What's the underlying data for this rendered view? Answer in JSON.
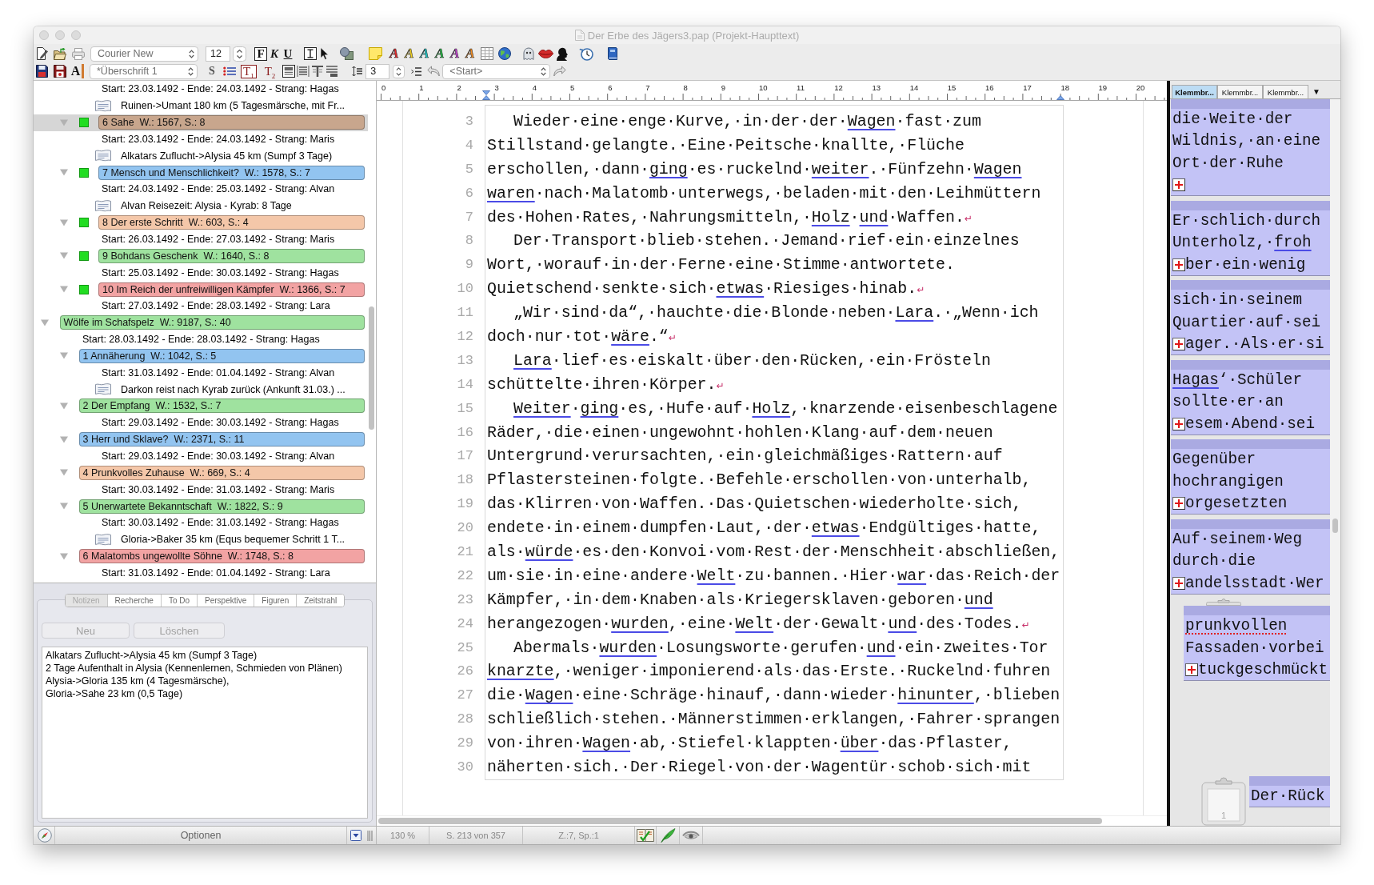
{
  "window": {
    "title": "Der Erbe des Jägers3.pap (Projekt-Haupttext)"
  },
  "toolbar": {
    "font": {
      "value": "Courier New"
    },
    "font_size": {
      "value": "12"
    },
    "format_buttons": [
      {
        "kind": "bold",
        "label": "F",
        "pressed": true
      },
      {
        "kind": "italic",
        "label": "K",
        "pressed": false
      },
      {
        "kind": "underline",
        "label": "U",
        "pressed": false
      }
    ],
    "pointer_tools": [
      {
        "pressed": true
      },
      {
        "pressed": false
      }
    ],
    "highlight_buttons": [
      {
        "label": "A",
        "color": "#e8262a"
      },
      {
        "label": "A",
        "color": "#f0d020"
      },
      {
        "label": "A",
        "color": "#18c8c8"
      },
      {
        "label": "A",
        "color": "#20b840"
      },
      {
        "label": "A",
        "color": "#c040d0"
      },
      {
        "label": "A",
        "color": "#f08a20"
      }
    ],
    "style_button": {
      "label": "A"
    },
    "paragraph_style": {
      "value": "*Überschrift 1"
    },
    "s_button": {
      "label": "S"
    },
    "level_buttons": [
      {
        "label": "T$_{1}$",
        "pressed": true
      },
      {
        "label": "T$_{2}$",
        "pressed": false
      }
    ],
    "layout_buttons": [
      {
        "pressed": true
      },
      {
        "pressed": false
      },
      {
        "pressed": false
      },
      {
        "pressed": false
      }
    ],
    "line_spacing": {
      "value": "3"
    },
    "position": {
      "value": "<Start>"
    }
  },
  "outline": [
    {
      "children": [
        {
          "children": [
            {
              "kind": "dates",
              "text": "Start: 23.03.1492 - Ende: 24.03.1492 - Strang: Hagas",
              "selected": false
            },
            {
              "kind": "note",
              "text": "Ruinen->Umant 180 km (5 Tagesmärsche, mit Fr...",
              "selected": false
            }
          ]
        },
        {
          "kind": "chapter",
          "label": "6 Sahe  W.: 1567, S.: 8",
          "color": "#c8a68d",
          "expanded": true,
          "selected": true,
          "status_box": true,
          "children": [
            {
              "kind": "dates",
              "text": "Start: 23.03.1492 - Ende: 24.03.1492 - Strang: Maris",
              "selected": false
            },
            {
              "kind": "note",
              "text": "Alkatars Zuflucht->Alysia 45 km (Sumpf 3 Tage)",
              "selected": false
            }
          ]
        },
        {
          "kind": "chapter",
          "label": "7 Mensch und Menschlichkeit?  W.: 1578, S.: 7",
          "color": "#92c4f0",
          "expanded": true,
          "selected": false,
          "status_box": true,
          "children": [
            {
              "kind": "dates",
              "text": "Start: 24.03.1492 - Ende: 25.03.1492 - Strang: Alvan",
              "selected": false
            },
            {
              "kind": "note",
              "text": "Alvan Reisezeit: Alysia - Kyrab: 8 Tage",
              "selected": false
            }
          ]
        },
        {
          "kind": "chapter",
          "label": "8 Der erste Schritt  W.: 603, S.: 4",
          "color": "#f4c7a9",
          "expanded": true,
          "selected": false,
          "status_box": true,
          "children": [
            {
              "kind": "dates",
              "text": "Start: 26.03.1492 - Ende: 27.03.1492 - Strang: Maris",
              "selected": false
            }
          ]
        },
        {
          "kind": "chapter",
          "label": "9 Bohdans Geschenk  W.: 1640, S.: 8",
          "color": "#9fe29f",
          "expanded": true,
          "selected": false,
          "status_box": true,
          "children": [
            {
              "kind": "dates",
              "text": "Start: 25.03.1492 - Ende: 30.03.1492 - Strang: Hagas",
              "selected": false
            }
          ]
        },
        {
          "kind": "chapter",
          "label": "10 Im Reich der unfreiwilligen Kämpfer  W.: 1366, S.: 7",
          "color": "#f2a3a3",
          "expanded": true,
          "selected": false,
          "status_box": true,
          "children": [
            {
              "kind": "dates",
              "text": "Start: 27.03.1492 - Ende: 28.03.1492 - Strang: Lara",
              "selected": false
            }
          ]
        }
      ]
    },
    {
      "kind": "part",
      "label": "Wölfe im Schafspelz  W.: 9187, S.: 40",
      "color": "#9fe29f",
      "expanded": true,
      "selected": false,
      "status_box": false,
      "children": [
        {
          "kind": "dates",
          "text": "Start: 28.03.1492 - Ende: 28.03.1492 - Strang: Hagas",
          "selected": false
        },
        {
          "kind": "chapter",
          "label": "1 Annäherung  W.: 1042, S.: 5",
          "color": "#92c4f0",
          "expanded": true,
          "selected": false,
          "status_box": false,
          "children": [
            {
              "kind": "dates",
              "text": "Start: 31.03.1492 - Ende: 01.04.1492 - Strang: Alvan",
              "selected": false
            },
            {
              "kind": "note",
              "text": "Darkon reist nach Kyrab zurück (Ankunft 31.03.) ...",
              "selected": false
            }
          ]
        },
        {
          "kind": "chapter",
          "label": "2 Der Empfang  W.: 1532, S.: 7",
          "color": "#9fe29f",
          "expanded": true,
          "selected": false,
          "status_box": false,
          "children": [
            {
              "kind": "dates",
              "text": "Start: 29.03.1492 - Ende: 30.03.1492 - Strang: Hagas",
              "selected": false
            }
          ]
        },
        {
          "kind": "chapter",
          "label": "3 Herr und Sklave?  W.: 2371, S.: 11",
          "color": "#92c4f0",
          "expanded": true,
          "selected": false,
          "status_box": false,
          "children": [
            {
              "kind": "dates",
              "text": "Start: 29.03.1492 - Ende: 30.03.1492 - Strang: Alvan",
              "selected": false
            }
          ]
        },
        {
          "kind": "chapter",
          "label": "4 Prunkvolles Zuhause  W.: 669, S.: 4",
          "color": "#f4c7a9",
          "expanded": true,
          "selected": false,
          "status_box": false,
          "children": [
            {
              "kind": "dates",
              "text": "Start: 30.03.1492 - Ende: 31.03.1492 - Strang: Maris",
              "selected": false
            }
          ]
        },
        {
          "kind": "chapter",
          "label": "5 Unerwartete Bekanntschaft  W.: 1822, S.: 9",
          "color": "#9fe29f",
          "expanded": true,
          "selected": false,
          "status_box": false,
          "children": [
            {
              "kind": "dates",
              "text": "Start: 30.03.1492 - Ende: 31.03.1492 - Strang: Hagas",
              "selected": false
            },
            {
              "kind": "note",
              "text": "Gloria->Baker 35 km (Equs bequemer Schritt 1 T...",
              "selected": false
            }
          ]
        },
        {
          "kind": "chapter",
          "label": "6 Malatombs ungewollte Söhne  W.: 1748, S.: 8",
          "color": "#f2a3a3",
          "expanded": true,
          "selected": false,
          "status_box": false,
          "children": [
            {
              "kind": "dates",
              "text": "Start: 31.03.1492 - Ende: 01.04.1492 - Strang: Lara",
              "selected": false
            }
          ]
        }
      ]
    }
  ],
  "notes_panel": {
    "tabs": [
      {
        "label": "Notizen",
        "selected": true
      },
      {
        "label": "Recherche",
        "selected": false
      },
      {
        "label": "To Do",
        "selected": false
      },
      {
        "label": "Perspektive",
        "selected": false
      },
      {
        "label": "Figuren",
        "selected": false
      },
      {
        "label": "Zeitstrahl",
        "selected": false
      }
    ],
    "buttons": [
      {
        "label": "Neu",
        "disabled": true
      },
      {
        "label": "Löschen",
        "disabled": true
      }
    ],
    "text_lines": [
      "Alkatars Zuflucht->Alysia 45 km (Sumpf 3 Tage)",
      "2 Tage Aufenthalt in Alysia (Kennenlernen, Schmieden von Plänen)",
      "Alysia->Gloria 135 km (4 Tagesmärsche),",
      "Gloria->Sahe 23 km (0,5 Tage)"
    ],
    "options_button": {
      "label": "Optionen"
    }
  },
  "ruler": {
    "labels": [
      "0",
      "1",
      "2",
      "3",
      "4",
      "5",
      "6",
      "7",
      "8",
      "9",
      "10",
      "11",
      "12",
      "13",
      "14",
      "15",
      "16",
      "17",
      "18",
      "19",
      "20"
    ]
  },
  "editor": {
    "lines": [
      {
        "number": "3",
        "indent": true,
        "segments": [
          {
            "kind": "plain",
            "text": "Wieder·eine·enge·Kurve,·in·der·der·"
          },
          {
            "kind": "marked",
            "text": "Wagen"
          },
          {
            "kind": "plain",
            "text": "·fast·zum"
          }
        ]
      },
      {
        "number": "4",
        "indent": false,
        "segments": [
          {
            "kind": "plain",
            "text": "Stillstand·gelangte.·Eine·Peitsche·knallte,·Flüche"
          }
        ]
      },
      {
        "number": "5",
        "indent": false,
        "segments": [
          {
            "kind": "plain",
            "text": "erschollen,·dann·"
          },
          {
            "kind": "marked",
            "text": "ging"
          },
          {
            "kind": "plain",
            "text": "·es·ruckelnd·"
          },
          {
            "kind": "marked",
            "text": "weiter"
          },
          {
            "kind": "plain",
            "text": ".·Fünfzehn·"
          },
          {
            "kind": "marked",
            "text": "Wagen"
          }
        ]
      },
      {
        "number": "6",
        "indent": false,
        "segments": [
          {
            "kind": "marked",
            "text": "waren"
          },
          {
            "kind": "plain",
            "text": "·nach·Malatomb·unterwegs,·beladen·mit·den·Leihmüttern"
          }
        ]
      },
      {
        "number": "7",
        "indent": false,
        "segments": [
          {
            "kind": "plain",
            "text": "des·Hohen·Rates,·Nahrungsmitteln,·"
          },
          {
            "kind": "marked",
            "text": "Holz"
          },
          {
            "kind": "plain",
            "text": "·"
          },
          {
            "kind": "marked",
            "text": "und"
          },
          {
            "kind": "plain",
            "text": "·Waffen."
          },
          {
            "kind": "return",
            "text": "↵"
          }
        ]
      },
      {
        "number": "8",
        "indent": true,
        "segments": [
          {
            "kind": "plain",
            "text": "Der·Transport·blieb·stehen.·Jemand·rief·ein·einzelnes"
          }
        ]
      },
      {
        "number": "9",
        "indent": false,
        "segments": [
          {
            "kind": "plain",
            "text": "Wort,·worauf·in·der·Ferne·eine·Stimme·antwortete."
          }
        ]
      },
      {
        "number": "10",
        "indent": false,
        "segments": [
          {
            "kind": "plain",
            "text": "Quietschend·senkte·sich·"
          },
          {
            "kind": "marked",
            "text": "etwas"
          },
          {
            "kind": "plain",
            "text": "·Riesiges·hinab."
          },
          {
            "kind": "return",
            "text": "↵"
          }
        ]
      },
      {
        "number": "11",
        "indent": true,
        "segments": [
          {
            "kind": "plain",
            "text": "„Wir·sind·da“,·hauchte·die·Blonde·neben·"
          },
          {
            "kind": "marked",
            "text": "Lara"
          },
          {
            "kind": "plain",
            "text": ".·„Wenn·ich"
          }
        ]
      },
      {
        "number": "12",
        "indent": false,
        "segments": [
          {
            "kind": "plain",
            "text": "doch·nur·tot·"
          },
          {
            "kind": "marked",
            "text": "wäre"
          },
          {
            "kind": "plain",
            "text": ".“"
          },
          {
            "kind": "return",
            "text": "↵"
          }
        ]
      },
      {
        "number": "13",
        "indent": true,
        "segments": [
          {
            "kind": "marked",
            "text": "Lara"
          },
          {
            "kind": "plain",
            "text": "·lief·es·eiskalt·über·den·Rücken,·ein·Frösteln"
          }
        ]
      },
      {
        "number": "14",
        "indent": false,
        "segments": [
          {
            "kind": "plain",
            "text": "schüttelte·ihren·Körper."
          },
          {
            "kind": "return",
            "text": "↵"
          }
        ]
      },
      {
        "number": "15",
        "indent": true,
        "segments": [
          {
            "kind": "marked",
            "text": "Weiter"
          },
          {
            "kind": "plain",
            "text": "·"
          },
          {
            "kind": "marked",
            "text": "ging"
          },
          {
            "kind": "plain",
            "text": "·es,·Hufe·auf·"
          },
          {
            "kind": "marked",
            "text": "Holz"
          },
          {
            "kind": "plain",
            "text": ",·knarzende·eisenbeschlagene"
          }
        ]
      },
      {
        "number": "16",
        "indent": false,
        "segments": [
          {
            "kind": "plain",
            "text": "Räder,·die·einen·ungewohnt·hohlen·Klang·auf·dem·neuen"
          }
        ]
      },
      {
        "number": "17",
        "indent": false,
        "segments": [
          {
            "kind": "plain",
            "text": "Untergrund·verursachten,·ein·gleichmäßiges·Rattern·auf"
          }
        ]
      },
      {
        "number": "18",
        "indent": false,
        "segments": [
          {
            "kind": "plain",
            "text": "Pflastersteinen·folgte.·Befehle·erschollen·von·unterhalb,"
          }
        ]
      },
      {
        "number": "19",
        "indent": false,
        "segments": [
          {
            "kind": "plain",
            "text": "das·Klirren·von·Waffen.·Das·Quietschen·wiederholte·sich,"
          }
        ]
      },
      {
        "number": "20",
        "indent": false,
        "segments": [
          {
            "kind": "plain",
            "text": "endete·in·einem·dumpfen·Laut,·der·"
          },
          {
            "kind": "marked",
            "text": "etwas"
          },
          {
            "kind": "plain",
            "text": "·Endgültiges·hatte,"
          }
        ]
      },
      {
        "number": "21",
        "indent": false,
        "segments": [
          {
            "kind": "plain",
            "text": "als·"
          },
          {
            "kind": "marked",
            "text": "würde"
          },
          {
            "kind": "plain",
            "text": "·es·den·Konvoi·vom·Rest·der·Menschheit·abschließen,"
          }
        ]
      },
      {
        "number": "22",
        "indent": false,
        "segments": [
          {
            "kind": "plain",
            "text": "um·sie·in·eine·andere·"
          },
          {
            "kind": "marked",
            "text": "Welt"
          },
          {
            "kind": "plain",
            "text": "·zu·bannen.·Hier·"
          },
          {
            "kind": "marked",
            "text": "war"
          },
          {
            "kind": "plain",
            "text": "·das·Reich·der"
          }
        ]
      },
      {
        "number": "23",
        "indent": false,
        "segments": [
          {
            "kind": "plain",
            "text": "Kämpfer,·in·dem·Knaben·als·Kriegersklaven·geboren·"
          },
          {
            "kind": "marked",
            "text": "und"
          }
        ]
      },
      {
        "number": "24",
        "indent": false,
        "segments": [
          {
            "kind": "plain",
            "text": "herangezogen·"
          },
          {
            "kind": "marked",
            "text": "wurden"
          },
          {
            "kind": "plain",
            "text": ",·eine·"
          },
          {
            "kind": "marked",
            "text": "Welt"
          },
          {
            "kind": "plain",
            "text": "·der·Gewalt·"
          },
          {
            "kind": "marked",
            "text": "und"
          },
          {
            "kind": "plain",
            "text": "·des·Todes."
          },
          {
            "kind": "return",
            "text": "↵"
          }
        ]
      },
      {
        "number": "25",
        "indent": true,
        "segments": [
          {
            "kind": "plain",
            "text": "Abermals·"
          },
          {
            "kind": "marked",
            "text": "wurden"
          },
          {
            "kind": "plain",
            "text": "·Losungsworte·gerufen·"
          },
          {
            "kind": "marked",
            "text": "und"
          },
          {
            "kind": "plain",
            "text": "·ein·zweites·Tor"
          }
        ]
      },
      {
        "number": "26",
        "indent": false,
        "segments": [
          {
            "kind": "marked",
            "text": "knarzte"
          },
          {
            "kind": "plain",
            "text": ",·weniger·imponierend·als·das·Erste.·Ruckelnd·fuhren"
          }
        ]
      },
      {
        "number": "27",
        "indent": false,
        "segments": [
          {
            "kind": "plain",
            "text": "die·"
          },
          {
            "kind": "marked",
            "text": "Wagen"
          },
          {
            "kind": "plain",
            "text": "·eine·Schräge·hinauf,·dann·wieder·"
          },
          {
            "kind": "marked",
            "text": "hinunter"
          },
          {
            "kind": "plain",
            "text": ",·blieben"
          }
        ]
      },
      {
        "number": "28",
        "indent": false,
        "segments": [
          {
            "kind": "plain",
            "text": "schließlich·stehen.·Männerstimmen·erklangen,·Fahrer·sprangen"
          }
        ]
      },
      {
        "number": "29",
        "indent": false,
        "segments": [
          {
            "kind": "plain",
            "text": "von·ihren·"
          },
          {
            "kind": "marked",
            "text": "Wagen"
          },
          {
            "kind": "plain",
            "text": "·ab,·Stiefel·klappten·"
          },
          {
            "kind": "marked",
            "text": "über"
          },
          {
            "kind": "plain",
            "text": "·das·Pflaster,"
          }
        ]
      },
      {
        "number": "30",
        "indent": false,
        "segments": [
          {
            "kind": "plain",
            "text": "näherten·sich.·Der·Riegel·von·der·Wagentür·schob·sich·mit"
          }
        ]
      }
    ]
  },
  "clipboard_panel": {
    "tabs": [
      {
        "label": "Klemmbr...",
        "selected": true
      },
      {
        "label": "Klemmbr...",
        "selected": false
      },
      {
        "label": "Klemmbr...",
        "selected": false
      }
    ],
    "tab_menu": "▼",
    "cards": [
      {
        "lines": [
          [
            {
              "kind": "plain",
              "text": "die·Weite·der"
            }
          ],
          [
            {
              "kind": "plain",
              "text": "Wildnis,·an·eine"
            }
          ],
          [
            {
              "kind": "plain",
              "text": "Ort·der·Ruhe"
            }
          ]
        ],
        "add_button": true
      },
      {
        "lines": [
          [
            {
              "kind": "plain",
              "text": "Er·schlich·durch"
            }
          ],
          [
            {
              "kind": "plain",
              "text": "Unterholz,·"
            },
            {
              "kind": "marked",
              "text": "froh"
            }
          ]
        ],
        "add_button": true,
        "button_line": [
          {
            "kind": "plain",
            "text": "ber·ein·wenig"
          }
        ]
      },
      {
        "lines": [
          [
            {
              "kind": "plain",
              "text": "sich·in·seinem"
            }
          ],
          [
            {
              "kind": "plain",
              "text": "Quartier·auf·sei"
            }
          ]
        ],
        "add_button": true,
        "button_line": [
          {
            "kind": "plain",
            "text": "ager.·Als·er·si"
          }
        ]
      },
      {
        "lines": [
          [
            {
              "kind": "marked",
              "text": "Hagas"
            },
            {
              "kind": "plain",
              "text": "‘·Schüler"
            }
          ],
          [
            {
              "kind": "plain",
              "text": "sollte·er·an"
            }
          ]
        ],
        "add_button": true,
        "button_line": [
          {
            "kind": "plain",
            "text": "esem·Abend·sei"
          }
        ]
      },
      {
        "lines": [
          [
            {
              "kind": "plain",
              "text": "Gegenüber"
            }
          ],
          [
            {
              "kind": "plain",
              "text": "hochrangigen"
            }
          ]
        ],
        "add_button": true,
        "button_line": [
          {
            "kind": "plain",
            "text": "orgesetzten"
          }
        ]
      },
      {
        "lines": [
          [
            {
              "kind": "plain",
              "text": "Auf·seinem·Weg"
            }
          ],
          [
            {
              "kind": "plain",
              "text": "durch·die"
            }
          ]
        ],
        "add_button": true,
        "button_line": [
          {
            "kind": "plain",
            "text": "andelsstadt·Wer"
          }
        ],
        "children": [
          {
            "lines": [
              [
                {
                  "kind": "misspelled",
                  "text": "prunkvollen"
                }
              ],
              [
                {
                  "kind": "plain",
                  "text": "Fassaden·vorbei"
                }
              ]
            ],
            "add_button": true,
            "button_line": [
              {
                "kind": "plain",
                "text": "tuckgeschmückt"
              }
            ]
          }
        ]
      }
    ],
    "clipboard_group": {
      "number": "1",
      "cards": [
        {
          "lines": [
            [
              {
                "kind": "plain",
                "text": "Der·Rück"
              }
            ]
          ],
          "add_button": false
        }
      ]
    }
  },
  "status_bar": {
    "zoom": "130 %",
    "page": "S. 213 von 357",
    "cursor": "Z.:7, Sp.:1"
  }
}
